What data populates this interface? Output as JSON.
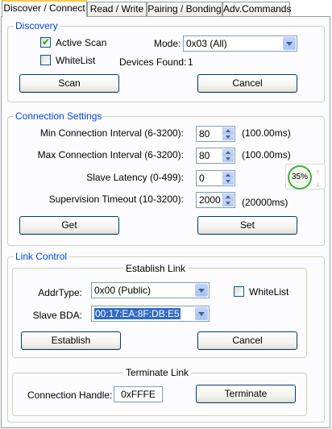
{
  "tabs": [
    "Discover / Connect",
    "Read / Write",
    "Pairing / Bonding",
    "Adv.Commands"
  ],
  "discovery": {
    "title": "Discovery",
    "active_scan_label": "Active Scan",
    "active_scan_checked": true,
    "whitelist_label": "WhiteList",
    "whitelist_checked": false,
    "mode_label": "Mode:",
    "mode_value": "0x03 (All)",
    "devices_found_label": "Devices Found:",
    "devices_found_value": "1",
    "scan_label": "Scan",
    "cancel_label": "Cancel"
  },
  "connection": {
    "title": "Connection Settings",
    "min_interval_label": "Min Connection Interval (6-3200):",
    "min_interval_value": "80",
    "min_interval_ms": "(100.00ms)",
    "max_interval_label": "Max Connection Interval (6-3200):",
    "max_interval_value": "80",
    "max_interval_ms": "(100.00ms)",
    "slave_latency_label": "Slave Latency (0-499):",
    "slave_latency_value": "0",
    "supervision_label": "Supervision Timeout (10-3200):",
    "supervision_value": "2000",
    "supervision_ms": "(20000ms)",
    "get_label": "Get",
    "set_label": "Set"
  },
  "link": {
    "title": "Link Control",
    "establish_title": "Establish Link",
    "addr_type_label": "AddrType:",
    "addr_type_value": "0x00 (Public)",
    "whitelist_label": "WhiteList",
    "whitelist_checked": false,
    "slave_bda_label": "Slave BDA:",
    "slave_bda_value": "00:17:EA:8F:DB:E5",
    "establish_label": "Establish",
    "cancel_label": "Cancel",
    "terminate_title": "Terminate Link",
    "conn_handle_label": "Connection Handle:",
    "conn_handle_value": "0xFFFE",
    "terminate_label": "Terminate"
  },
  "overlay": {
    "percent": "35%",
    "up_arrow": "↑",
    "down_arrow": "↓",
    "up_color": "#e8702a",
    "down_color": "#2f9a2f"
  }
}
